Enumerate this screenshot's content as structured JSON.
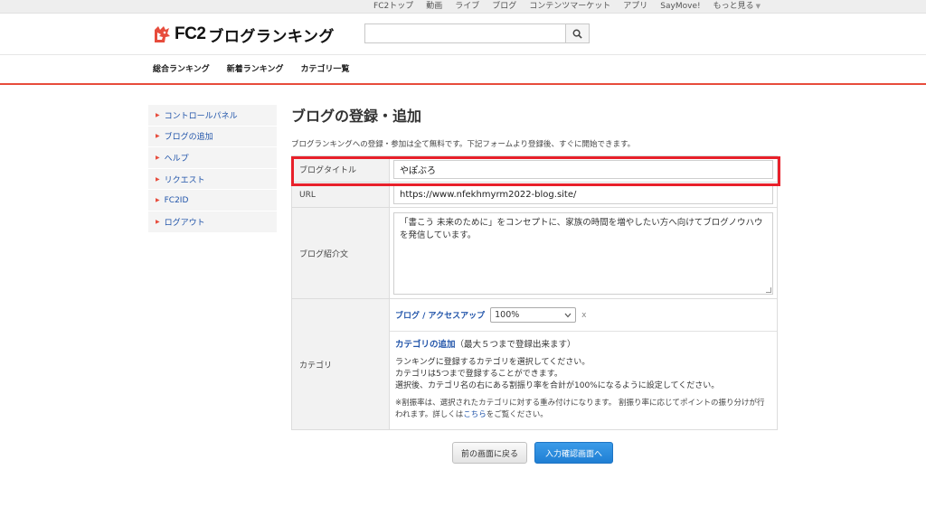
{
  "topnav": {
    "items": [
      "FC2トップ",
      "動画",
      "ライブ",
      "ブログ",
      "コンテンツマーケット",
      "アプリ",
      "SayMove!",
      "もっと見る"
    ]
  },
  "header": {
    "logo_fc2": "FC2",
    "logo_text": "ブログランキング",
    "search_value": ""
  },
  "subnav": {
    "items": [
      "総合ランキング",
      "新着ランキング",
      "カテゴリ一覧"
    ]
  },
  "sidebar": {
    "items": [
      "コントロールパネル",
      "ブログの追加",
      "ヘルプ",
      "リクエスト",
      "FC2ID",
      "ログアウト"
    ]
  },
  "main": {
    "title": "ブログの登録・追加",
    "intro": "ブログランキングへの登録・参加は全て無料です。下記フォームより登録後、すぐに開始できます。",
    "form": {
      "blog_title_label": "ブログタイトル",
      "blog_title_value": "やぽぶろ",
      "url_label": "URL",
      "url_value": "https://www.nfekhmyrm2022-blog.site/",
      "intro_label": "ブログ紹介文",
      "intro_value": "「書こう 未来のために」をコンセプトに、家族の時間を増やしたい方へ向けてブログノウハウを発信しています。",
      "category_label": "カテゴリ",
      "category_link": "ブログ / アクセスアップ",
      "category_ratio": "100%",
      "category_remove": "x",
      "category_add_link": "カテゴリの追加",
      "category_add_note": "（最大５つまで登録出来ます）",
      "desc1": "ランキングに登録するカテゴリを選択してください。",
      "desc2": "カテゴリは5つまで登録することができます。",
      "desc3": "選択後、カテゴリ名の右にある割振り率を合計が100%になるように設定してください。",
      "note_before": "※割振率は、選択されたカテゴリに対する重み付けになります。 割振り率に応じてポイントの振り分けが行われます。詳しくは",
      "note_link": "こちら",
      "note_after": "をご覧ください。"
    },
    "buttons": {
      "back": "前の画面に戻る",
      "next": "入力確認画面へ"
    }
  },
  "colors": {
    "accent_red": "#e74c3c",
    "link_blue": "#2255aa",
    "highlight_red": "#e8202a",
    "primary_button": "#1f7fd4"
  }
}
